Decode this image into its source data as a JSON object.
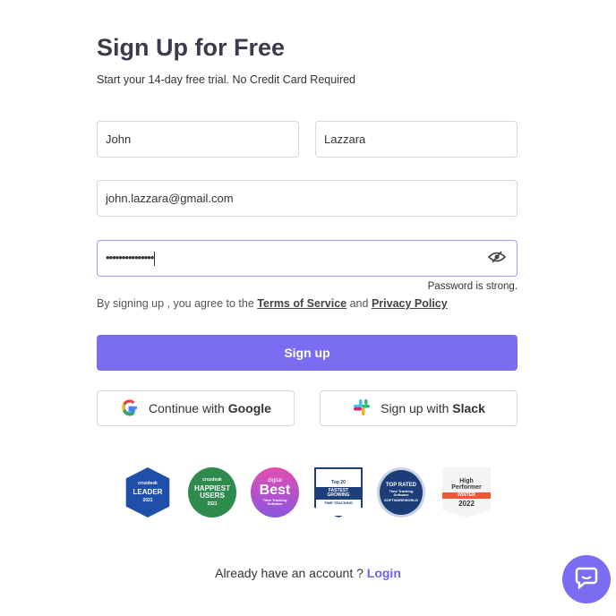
{
  "header": {
    "title": "Sign Up for Free",
    "subtitle": "Start your 14-day free trial. No Credit Card Required"
  },
  "form": {
    "first_name": "John",
    "last_name": "Lazzara",
    "email": "john.lazzara@gmail.com",
    "password_masked": "•••••••••••••••",
    "password_strength": "Password is strong.",
    "terms_prefix": "By signing up , you agree to the ",
    "terms_link": "Terms of Service",
    "terms_and": " and ",
    "privacy_link": "Privacy Policy",
    "signup_label": "Sign up"
  },
  "social": {
    "google_prefix": "Continue with ",
    "google_brand": "Google",
    "slack_prefix": "Sign up with ",
    "slack_brand": "Slack"
  },
  "badges": [
    {
      "top": "crozdesk",
      "main": "LEADER",
      "bottom": "2021",
      "color": "#1f4fa8"
    },
    {
      "top": "crozdesk",
      "main": "HAPPIEST USERS",
      "bottom": "2021",
      "color": "#2f8a4e"
    },
    {
      "top": "digital",
      "main": "Best",
      "bottom": "Time Tracking Software",
      "color": "#a94fd6"
    },
    {
      "top": "Top 20",
      "main": "FASTEST GROWING",
      "bottom": "TIME TRACKING",
      "color": "#1f3f7a"
    },
    {
      "top": "TOP RATED",
      "main": "Time Tracking Software",
      "bottom": "SOFTWAREWORLD",
      "color": "#1d3d78"
    },
    {
      "top": "High Performer",
      "main": "WINTER",
      "bottom": "2022",
      "color": "#ef5a36"
    }
  ],
  "footer": {
    "prompt": "Already have an account ? ",
    "login_link": "Login"
  },
  "colors": {
    "accent": "#7a6df2"
  }
}
